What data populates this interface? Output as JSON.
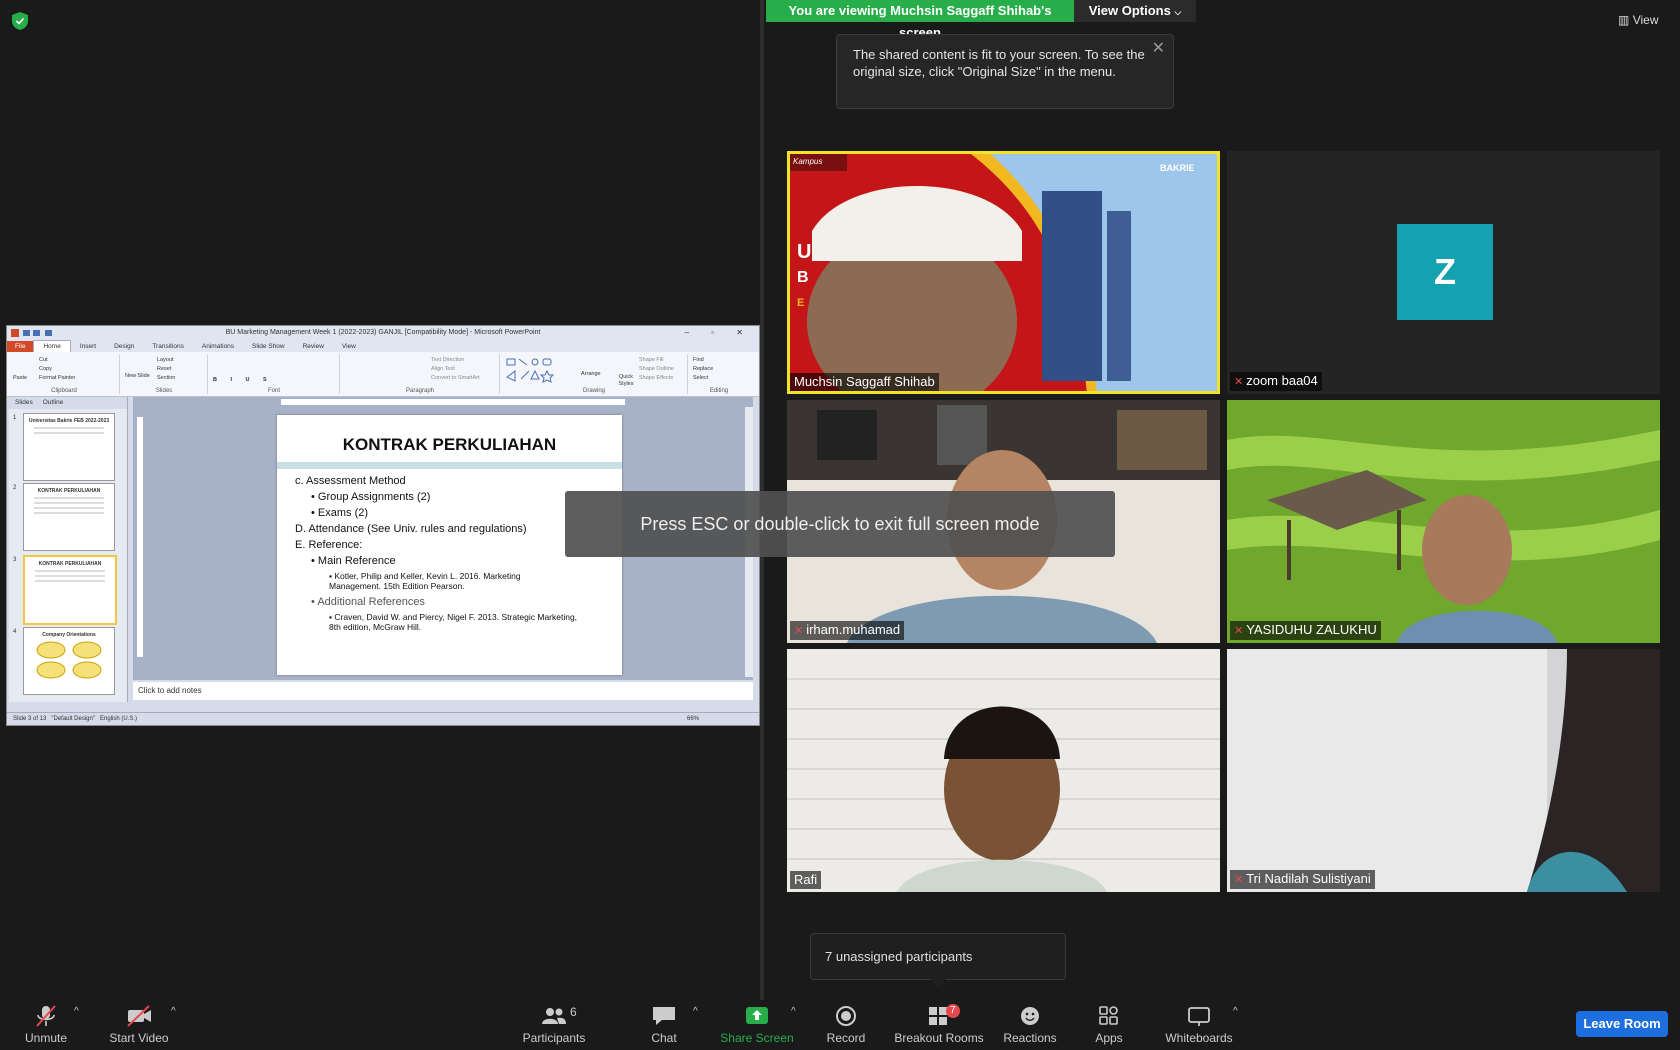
{
  "share_banner": {
    "viewing_text": "You are viewing Muchsin Saggaff Shihab's screen",
    "view_options_label": "View Options",
    "tooltip_text": "The shared content is fit to your screen. To see the original size, click \"Original Size\" in the menu.",
    "view_label": "View"
  },
  "fullscreen_hint": "Press ESC or double-click to exit full screen mode",
  "powerpoint": {
    "window_title": "BU Marketing Management Week 1 (2022-2023) GANJIL [Compatibility Mode] - Microsoft PowerPoint",
    "tabs": [
      "File",
      "Home",
      "Insert",
      "Design",
      "Transitions",
      "Animations",
      "Slide Show",
      "Review",
      "View"
    ],
    "ribbon_groups": [
      "Clipboard",
      "Slides",
      "Font",
      "Paragraph",
      "Drawing",
      "Editing"
    ],
    "clipboard_items": [
      "Cut",
      "Copy",
      "Format Painter"
    ],
    "slides_items": [
      "Layout",
      "Reset",
      "Section"
    ],
    "paste_label": "Paste",
    "new_slide_label": "New Slide",
    "editing_items": [
      "Find",
      "Replace",
      "Select"
    ],
    "paragraph_items": [
      "Text Direction",
      "Align Text",
      "Convert to SmartArt"
    ],
    "drawing_items": [
      "Shape Fill",
      "Shape Outline",
      "Shape Effects"
    ],
    "arrange_label": "Arrange",
    "quick_styles_label": "Quick Styles",
    "pane_tabs": [
      "Slides",
      "Outline"
    ],
    "thumbnails": [
      {
        "num": "1",
        "title": "Universitas Bakrie FEB 2022-2023"
      },
      {
        "num": "2",
        "title": "KONTRAK PERKULIAHAN"
      },
      {
        "num": "3",
        "title": "KONTRAK PERKULIAHAN"
      },
      {
        "num": "4",
        "title": "Company Orientations"
      }
    ],
    "slide": {
      "title": "KONTRAK PERKULIAHAN",
      "c_label": "c.",
      "c_text": "Assessment Method",
      "c_bullets": [
        "Group Assignments (2)",
        "Exams (2)"
      ],
      "d_text": "D. Attendance (See Univ. rules and regulations)",
      "e_text": "E. Reference:",
      "main_ref_label": "Main Reference",
      "main_ref": "Kotler, Philip and Keller, Kevin L. 2016. Marketing Management. 15th Edition Pearson.",
      "add_ref_label": "Additional References",
      "add_ref": "Craven, David W. and Piercy, Nigel F. 2013. Strategic Marketing, 8th edition, McGraw Hill."
    },
    "notes_placeholder": "Click to add notes",
    "status": {
      "slide_pos": "Slide 3 of 13",
      "theme": "\"Default Design\"",
      "language": "English (U.S.)",
      "zoom": "66%"
    }
  },
  "participants": [
    {
      "name": "Muchsin Saggaff Shihab",
      "muted": false,
      "active": true
    },
    {
      "name": "zoom baa04",
      "muted": true,
      "avatar_letter": "Z"
    },
    {
      "name": "irham.muhamad",
      "muted": true
    },
    {
      "name": "YASIDUHU ZALUKHU",
      "muted": true
    },
    {
      "name": "Rafi",
      "muted": false
    },
    {
      "name": "Tri Nadilah Sulistiyani",
      "muted": true
    }
  ],
  "tile_overlay_text": {
    "line1": "U",
    "line2": "B",
    "line3": "E",
    "brand": "BAKRIE",
    "corner": "Kampus"
  },
  "unassigned_text": "7 unassigned participants",
  "toolbar": {
    "unmute": "Unmute",
    "start_video": "Start Video",
    "participants": "Participants",
    "participants_count": "6",
    "chat": "Chat",
    "share_screen": "Share Screen",
    "record": "Record",
    "breakout_rooms": "Breakout Rooms",
    "breakout_badge": "7",
    "reactions": "Reactions",
    "apps": "Apps",
    "whiteboards": "Whiteboards",
    "leave_room": "Leave Room"
  },
  "colors": {
    "banner_green": "#27ae4a",
    "active_speaker": "#f0e32a",
    "leave_blue": "#1d6fe0",
    "muted_red": "#e5484d",
    "avatar_teal": "#16a1b0"
  }
}
